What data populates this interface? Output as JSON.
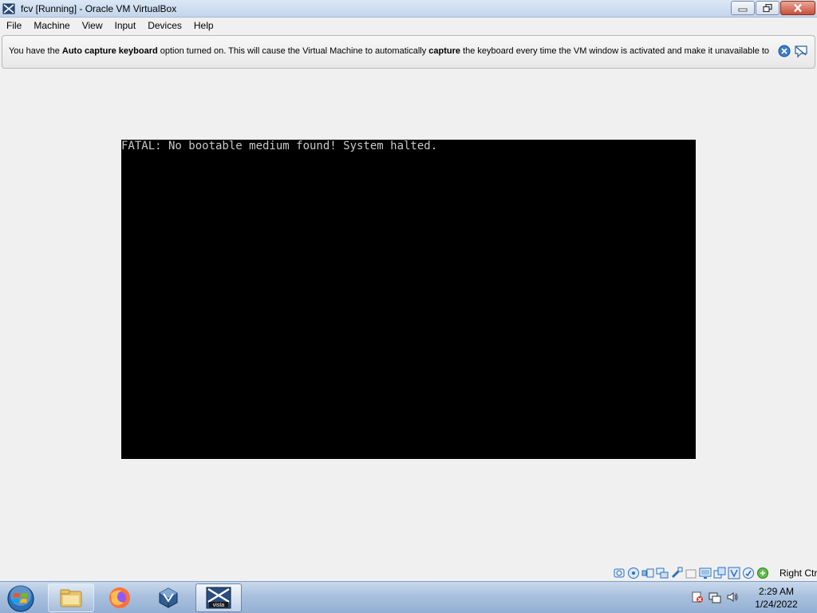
{
  "window": {
    "title": "fcv [Running] - Oracle VM VirtualBox"
  },
  "menu": {
    "items": [
      "File",
      "Machine",
      "View",
      "Input",
      "Devices",
      "Help"
    ]
  },
  "notice": {
    "part1": "You have the ",
    "bold1": "Auto capture keyboard",
    "part2": " option turned on. This will cause the Virtual Machine to automatically ",
    "bold2": "capture",
    "part3": " the keyboard every time the VM window is activated and make it unavailable to"
  },
  "vm": {
    "console_text": "FATAL: No bootable medium found! System halted."
  },
  "statusbar": {
    "icons": [
      "hard-disk-icon",
      "optical-drive-icon",
      "audio-icon",
      "network-icon",
      "usb-icon",
      "shared-folders-icon",
      "display-icon",
      "video-capture-icon",
      "virtualization-icon",
      "mouse-integration-icon",
      "keyboard-capture-icon"
    ],
    "host_key": "Right Ctrl"
  },
  "taskbar": {
    "pinned": [
      "windows-explorer",
      "firefox",
      "virtualbox-manager"
    ],
    "active_window_label": "vista",
    "clock_time": "2:29 AM",
    "clock_date": "1/24/2022"
  },
  "colors": {
    "vm_background": "#000000",
    "console_text": "#c8c8c8",
    "taskbar": "#a9c1de"
  }
}
